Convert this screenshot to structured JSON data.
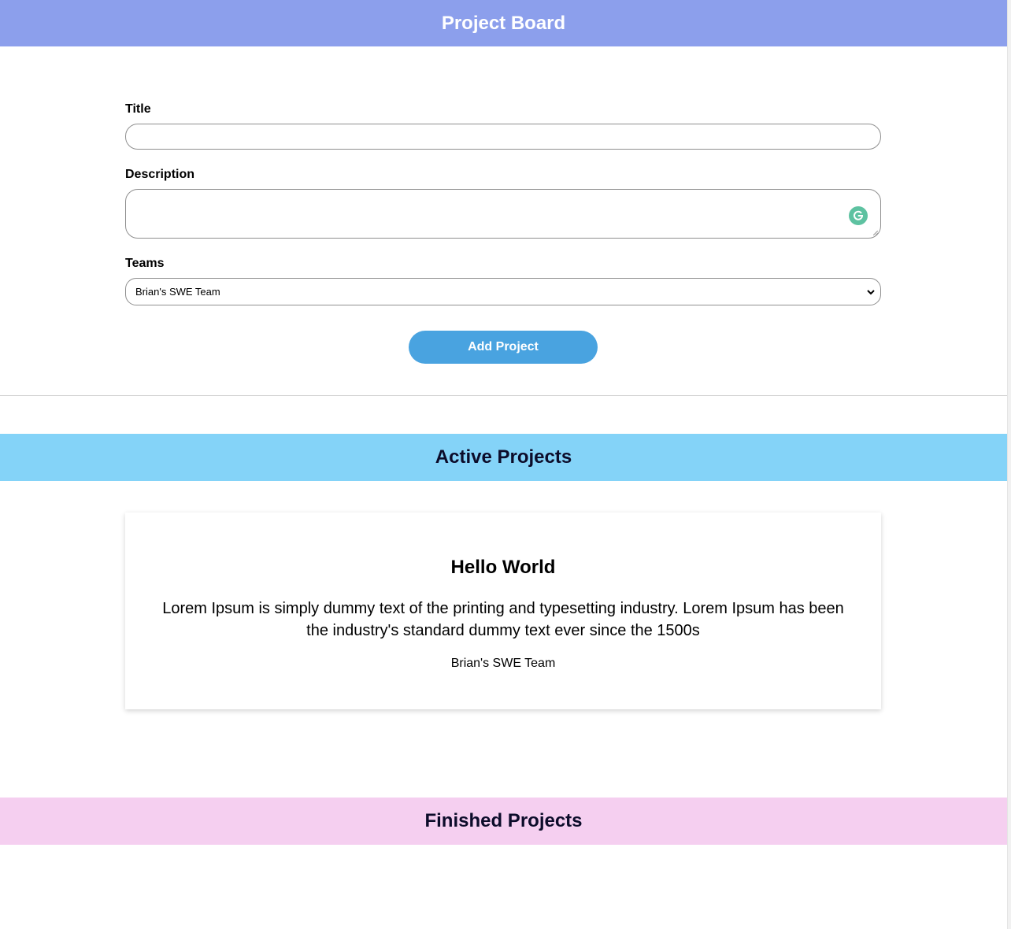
{
  "header": {
    "title": "Project Board"
  },
  "form": {
    "title_label": "Title",
    "title_value": "",
    "description_label": "Description",
    "description_value": "",
    "teams_label": "Teams",
    "teams_selected": "Brian's SWE Team",
    "submit_label": "Add Project"
  },
  "active": {
    "heading": "Active Projects",
    "projects": [
      {
        "title": "Hello World",
        "description": "Lorem Ipsum is simply dummy text of the printing and typesetting industry. Lorem Ipsum has been the industry's standard dummy text ever since the 1500s",
        "team": "Brian's SWE Team"
      }
    ]
  },
  "finished": {
    "heading": "Finished Projects"
  },
  "icons": {
    "grammarly": "grammarly-icon",
    "select_chevron": "chevron-down-icon"
  },
  "colors": {
    "header_bg": "#8c9fec",
    "button_bg": "#49a3e0",
    "active_band": "#84d3f8",
    "finished_band": "#f5cff0",
    "grammarly": "#5ec2a1"
  }
}
